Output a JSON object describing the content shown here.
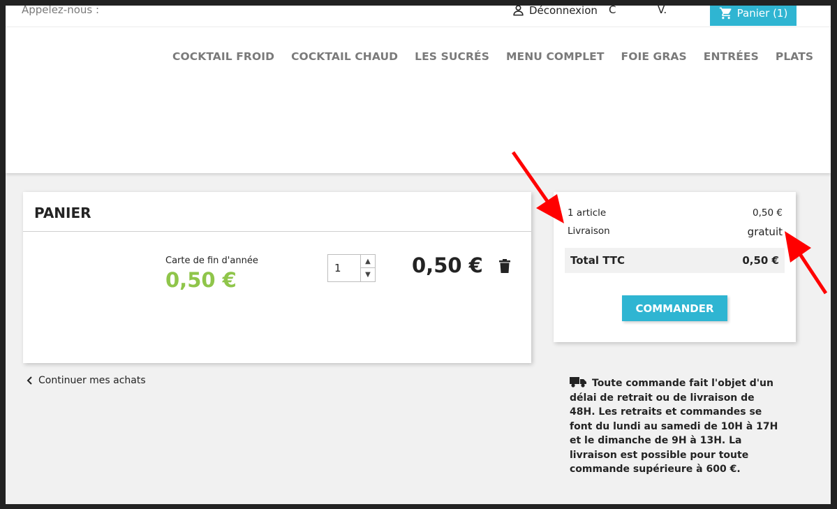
{
  "topbar": {
    "call_us": "Appelez-nous :",
    "logout": "Déconnexion",
    "lang1": "C",
    "lang2": "V.",
    "cart": "Panier (1)"
  },
  "nav": [
    "COCKTAIL FROID",
    "COCKTAIL CHAUD",
    "LES SUCRÉS",
    "MENU COMPLET",
    "FOIE GRAS",
    "ENTRÉES",
    "PLATS"
  ],
  "cart": {
    "title": "PANIER",
    "product_name": "Carte de fin d'année",
    "unit_price": "0,50 €",
    "quantity": "1",
    "line_total": "0,50 €",
    "continue": "Continuer mes achats"
  },
  "summary": {
    "articles_label": "1 article",
    "articles_value": "0,50 €",
    "shipping_label": "Livraison",
    "shipping_value": "gratuit",
    "total_label": "Total TTC",
    "total_value": "0,50 €",
    "order_button": "COMMANDER"
  },
  "reassurance": "Toute commande fait l'objet d'un délai de retrait ou de livraison de 48H. Les retraits et commandes se font du lundi au samedi de 10H à 17H et le dimanche de 9H à 13H. La livraison est possible pour toute commande supérieure à 600 €.",
  "colors": {
    "accent": "#2fb5d2",
    "price_green": "#8fc54a",
    "annotation_red": "#ff0000"
  }
}
